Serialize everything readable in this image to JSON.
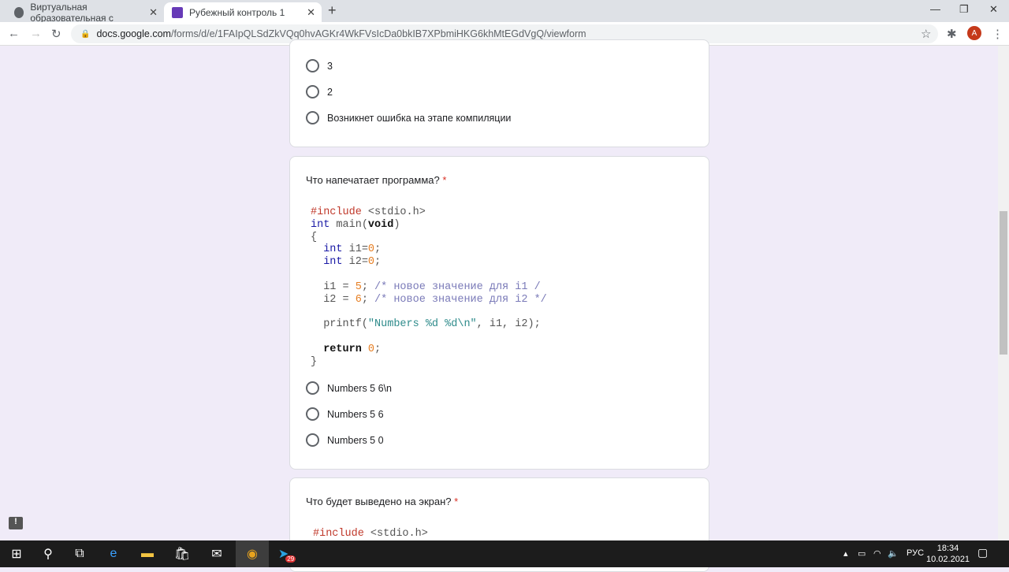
{
  "browser": {
    "tabs": [
      {
        "label": "Виртуальная образовательная с"
      },
      {
        "label": "Рубежный контроль 1"
      }
    ],
    "url_host": "docs.google.com",
    "url_path": "/forms/d/e/1FAIpQLSdZkVQq0hvAGKr4WkFVsIcDa0bkIB7XPbmiHKG6khMtEGdVgQ/viewform",
    "avatar": "A"
  },
  "q1": {
    "options": [
      "3",
      "2",
      "Возникнет ошибка на этапе компиляции"
    ]
  },
  "q2": {
    "title": "Что напечатает программа?",
    "required": "*",
    "code": [
      [
        [
          "#include",
          "pp"
        ],
        [
          " <stdio.h>",
          "pl"
        ]
      ],
      [
        [
          "int",
          "kw"
        ],
        [
          " main(",
          "pl"
        ],
        [
          "void",
          "b"
        ],
        [
          ")",
          "pl"
        ]
      ],
      [
        [
          "{",
          "pl"
        ]
      ],
      [
        [
          "  ",
          "pl"
        ],
        [
          "int",
          "kw"
        ],
        [
          " i1=",
          "pl"
        ],
        [
          "0",
          "num"
        ],
        [
          ";",
          "pl"
        ]
      ],
      [
        [
          "  ",
          "pl"
        ],
        [
          "int",
          "kw"
        ],
        [
          " i2=",
          "pl"
        ],
        [
          "0",
          "num"
        ],
        [
          ";",
          "pl"
        ]
      ],
      [
        [
          "",
          "pl"
        ]
      ],
      [
        [
          "  i1 = ",
          "pl"
        ],
        [
          "5",
          "num"
        ],
        [
          "; ",
          "pl"
        ],
        [
          "/* новое значение для i1 /",
          "cm"
        ]
      ],
      [
        [
          "  i2 = ",
          "pl"
        ],
        [
          "6",
          "num"
        ],
        [
          "; ",
          "pl"
        ],
        [
          "/* новое значение для i2 */",
          "cm"
        ]
      ],
      [
        [
          "",
          "pl"
        ]
      ],
      [
        [
          "  printf(",
          "pl"
        ],
        [
          "\"Numbers %d %d\\n\"",
          "str"
        ],
        [
          ", i1, i2);",
          "pl"
        ]
      ],
      [
        [
          "",
          "pl"
        ]
      ],
      [
        [
          "  ",
          "pl"
        ],
        [
          "return",
          "b"
        ],
        [
          " ",
          "pl"
        ],
        [
          "0",
          "num"
        ],
        [
          ";",
          "pl"
        ]
      ],
      [
        [
          "}",
          "pl"
        ]
      ]
    ],
    "options": [
      "Numbers 5 6\\n",
      "Numbers 5 6",
      "Numbers 5 0"
    ]
  },
  "q3": {
    "title": "Что будет выведено на экран?",
    "required": "*",
    "code_first": "#include",
    "code_rest": " <stdio.h>"
  },
  "taskbar": {
    "lang": "РУС",
    "time": "18:34",
    "date": "10.02.2021",
    "telegram_badge": "29"
  }
}
